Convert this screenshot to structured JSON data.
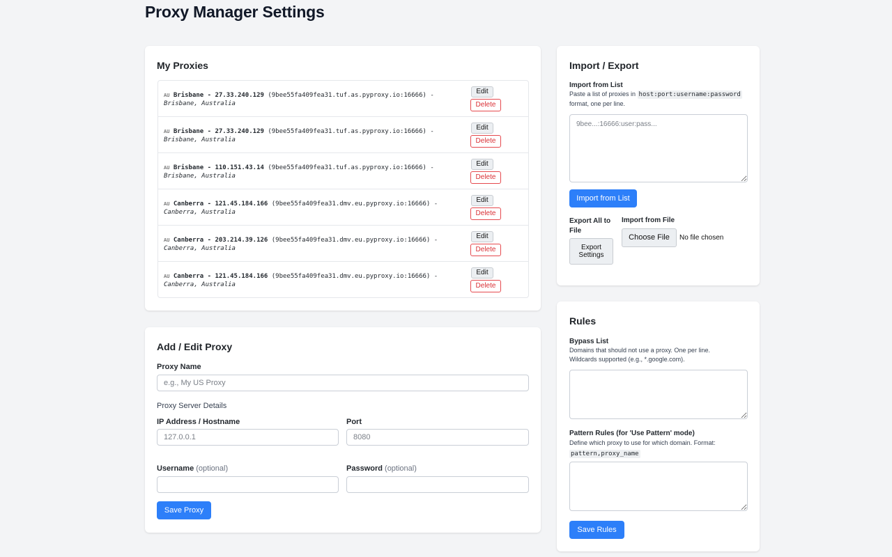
{
  "page": {
    "title": "Proxy Manager Settings"
  },
  "my_proxies": {
    "title": "My Proxies",
    "edit_label": "Edit",
    "delete_label": "Delete",
    "items": [
      {
        "flag": "AU",
        "name": "Brisbane - 27.33.240.129",
        "host": "(9bee55fa409fea31.tuf.as.pyproxy.io:16666)",
        "sep": " - ",
        "location": "Brisbane, Australia"
      },
      {
        "flag": "AU",
        "name": "Brisbane - 27.33.240.129",
        "host": "(9bee55fa409fea31.tuf.as.pyproxy.io:16666)",
        "sep": " - ",
        "location": "Brisbane, Australia"
      },
      {
        "flag": "AU",
        "name": "Brisbane - 110.151.43.14",
        "host": "(9bee55fa409fea31.tuf.as.pyproxy.io:16666)",
        "sep": " - ",
        "location": "Brisbane, Australia"
      },
      {
        "flag": "AU",
        "name": "Canberra - 121.45.184.166",
        "host": "(9bee55fa409fea31.dmv.eu.pyproxy.io:16666)",
        "sep": " - ",
        "location": "Canberra, Australia"
      },
      {
        "flag": "AU",
        "name": "Canberra - 203.214.39.126",
        "host": "(9bee55fa409fea31.dmv.eu.pyproxy.io:16666)",
        "sep": " - ",
        "location": "Canberra, Australia"
      },
      {
        "flag": "AU",
        "name": "Canberra - 121.45.184.166",
        "host": "(9bee55fa409fea31.dmv.eu.pyproxy.io:16666)",
        "sep": " - ",
        "location": "Canberra, Australia"
      }
    ]
  },
  "add_edit": {
    "title": "Add / Edit Proxy",
    "proxy_name_label": "Proxy Name",
    "proxy_name_placeholder": "e.g., My US Proxy",
    "server_details_label": "Proxy Server Details",
    "ip_label": "IP Address / Hostname",
    "ip_placeholder": "127.0.0.1",
    "port_label": "Port",
    "port_placeholder": "8080",
    "username_label": "Username",
    "password_label": "Password",
    "optional_text": "(optional)",
    "save_label": "Save Proxy"
  },
  "import_export": {
    "title": "Import / Export",
    "import_list_label": "Import from List",
    "help_prefix": "Paste a list of proxies in ",
    "help_code": "host:port:username:password",
    "help_suffix": " format, one per line.",
    "textarea_placeholder": "9bee...:16666:user:pass...",
    "import_button": "Import from List",
    "export_label": "Export All to File",
    "export_button": "Export Settings",
    "import_file_label": "Import from File",
    "choose_file_button": "Choose File",
    "no_file_text": "No file chosen"
  },
  "rules": {
    "title": "Rules",
    "bypass_label": "Bypass List",
    "bypass_help": "Domains that should not use a proxy. One per line. Wildcards supported (e.g., *.google.com).",
    "pattern_label": "Pattern Rules (for 'Use Pattern' mode)",
    "pattern_help_prefix": "Define which proxy to use for which domain. Format: ",
    "pattern_help_code": "pattern,proxy_name",
    "save_label": "Save Rules"
  }
}
